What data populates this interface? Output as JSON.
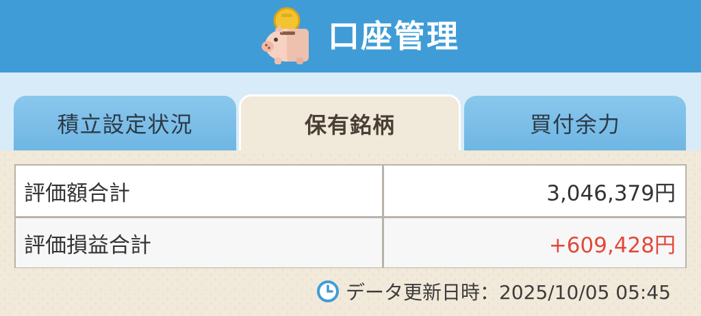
{
  "header": {
    "title": "口座管理",
    "icon": "piggy-bank-coin-icon"
  },
  "tabs": [
    {
      "label": "積立設定状況",
      "active": false
    },
    {
      "label": "保有銘柄",
      "active": true
    },
    {
      "label": "買付余力",
      "active": false
    }
  ],
  "summary": {
    "rows": [
      {
        "label": "評価額合計",
        "value": "3,046,379円"
      },
      {
        "label": "評価損益合計",
        "value": "+609,428円"
      }
    ]
  },
  "updated": {
    "icon": "clock-icon",
    "text": "データ更新日時：2025/10/05 05:45"
  },
  "colors": {
    "header": "#3f9cd6",
    "gain": "#e2483a",
    "tab_inactive": "#79bce7",
    "background": "#f1e9d9"
  }
}
